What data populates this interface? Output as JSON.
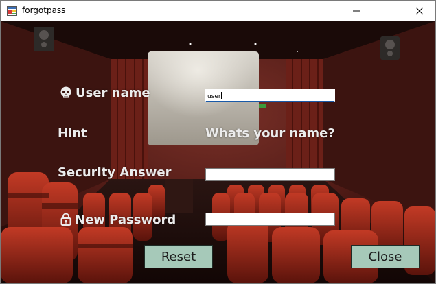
{
  "window": {
    "title": "forgotpass"
  },
  "form": {
    "username_label": "User name",
    "username_value": "user",
    "hint_label": "Hint",
    "hint_value": "Whats your name?",
    "security_answer_label": "Security Answer",
    "security_answer_value": "",
    "new_password_label": "New Password",
    "new_password_value": ""
  },
  "buttons": {
    "reset": "Reset",
    "close": "Close"
  },
  "colors": {
    "button_bg": "#a6c9b9",
    "label_text": "#ececec",
    "focus_underline": "#1a5aa8"
  }
}
